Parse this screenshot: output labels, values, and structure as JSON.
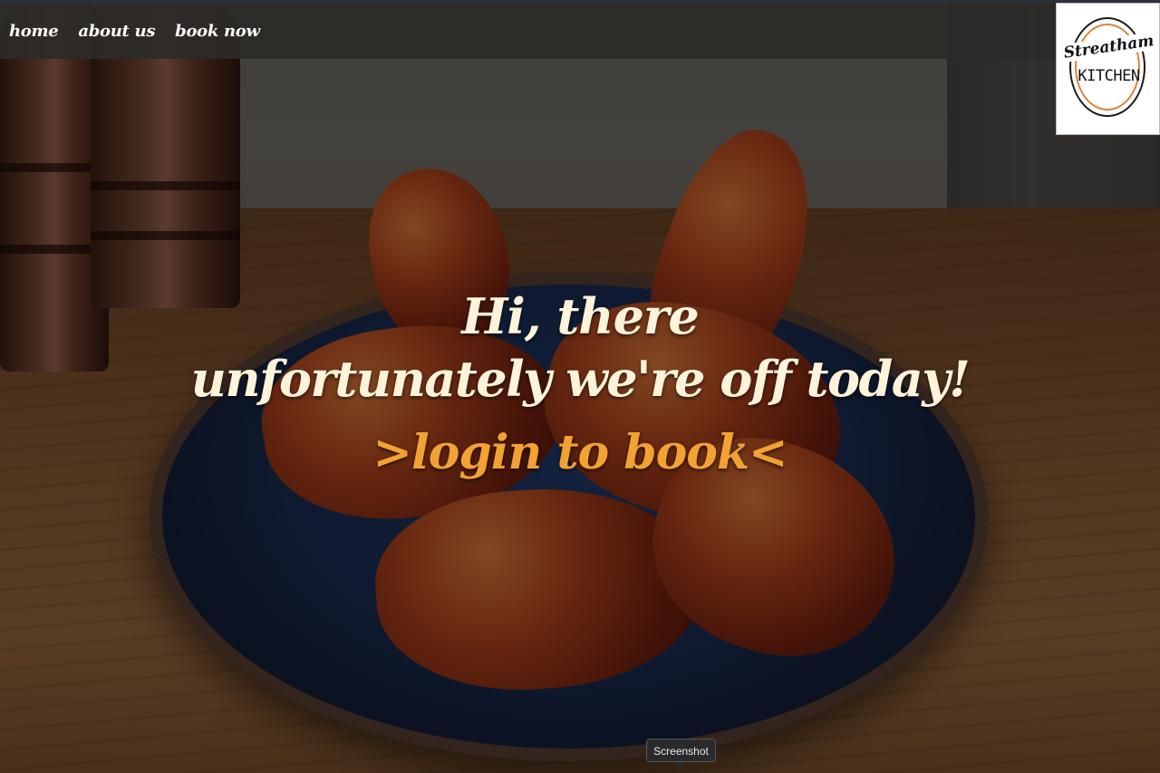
{
  "nav": {
    "links": [
      {
        "label": "home"
      },
      {
        "label": "about us"
      },
      {
        "label": "book now"
      }
    ]
  },
  "logo": {
    "script_text": "Streatham",
    "block_text": "KITCHEN",
    "accent_color": "#d9853b"
  },
  "hero": {
    "greeting": "Hi, there",
    "message": "unfortunately we're off today!",
    "cta_label": ">login to book<",
    "text_color": "#fdf3da",
    "cta_color": "#f2a233"
  },
  "tooltip": {
    "label": "Screenshot"
  }
}
